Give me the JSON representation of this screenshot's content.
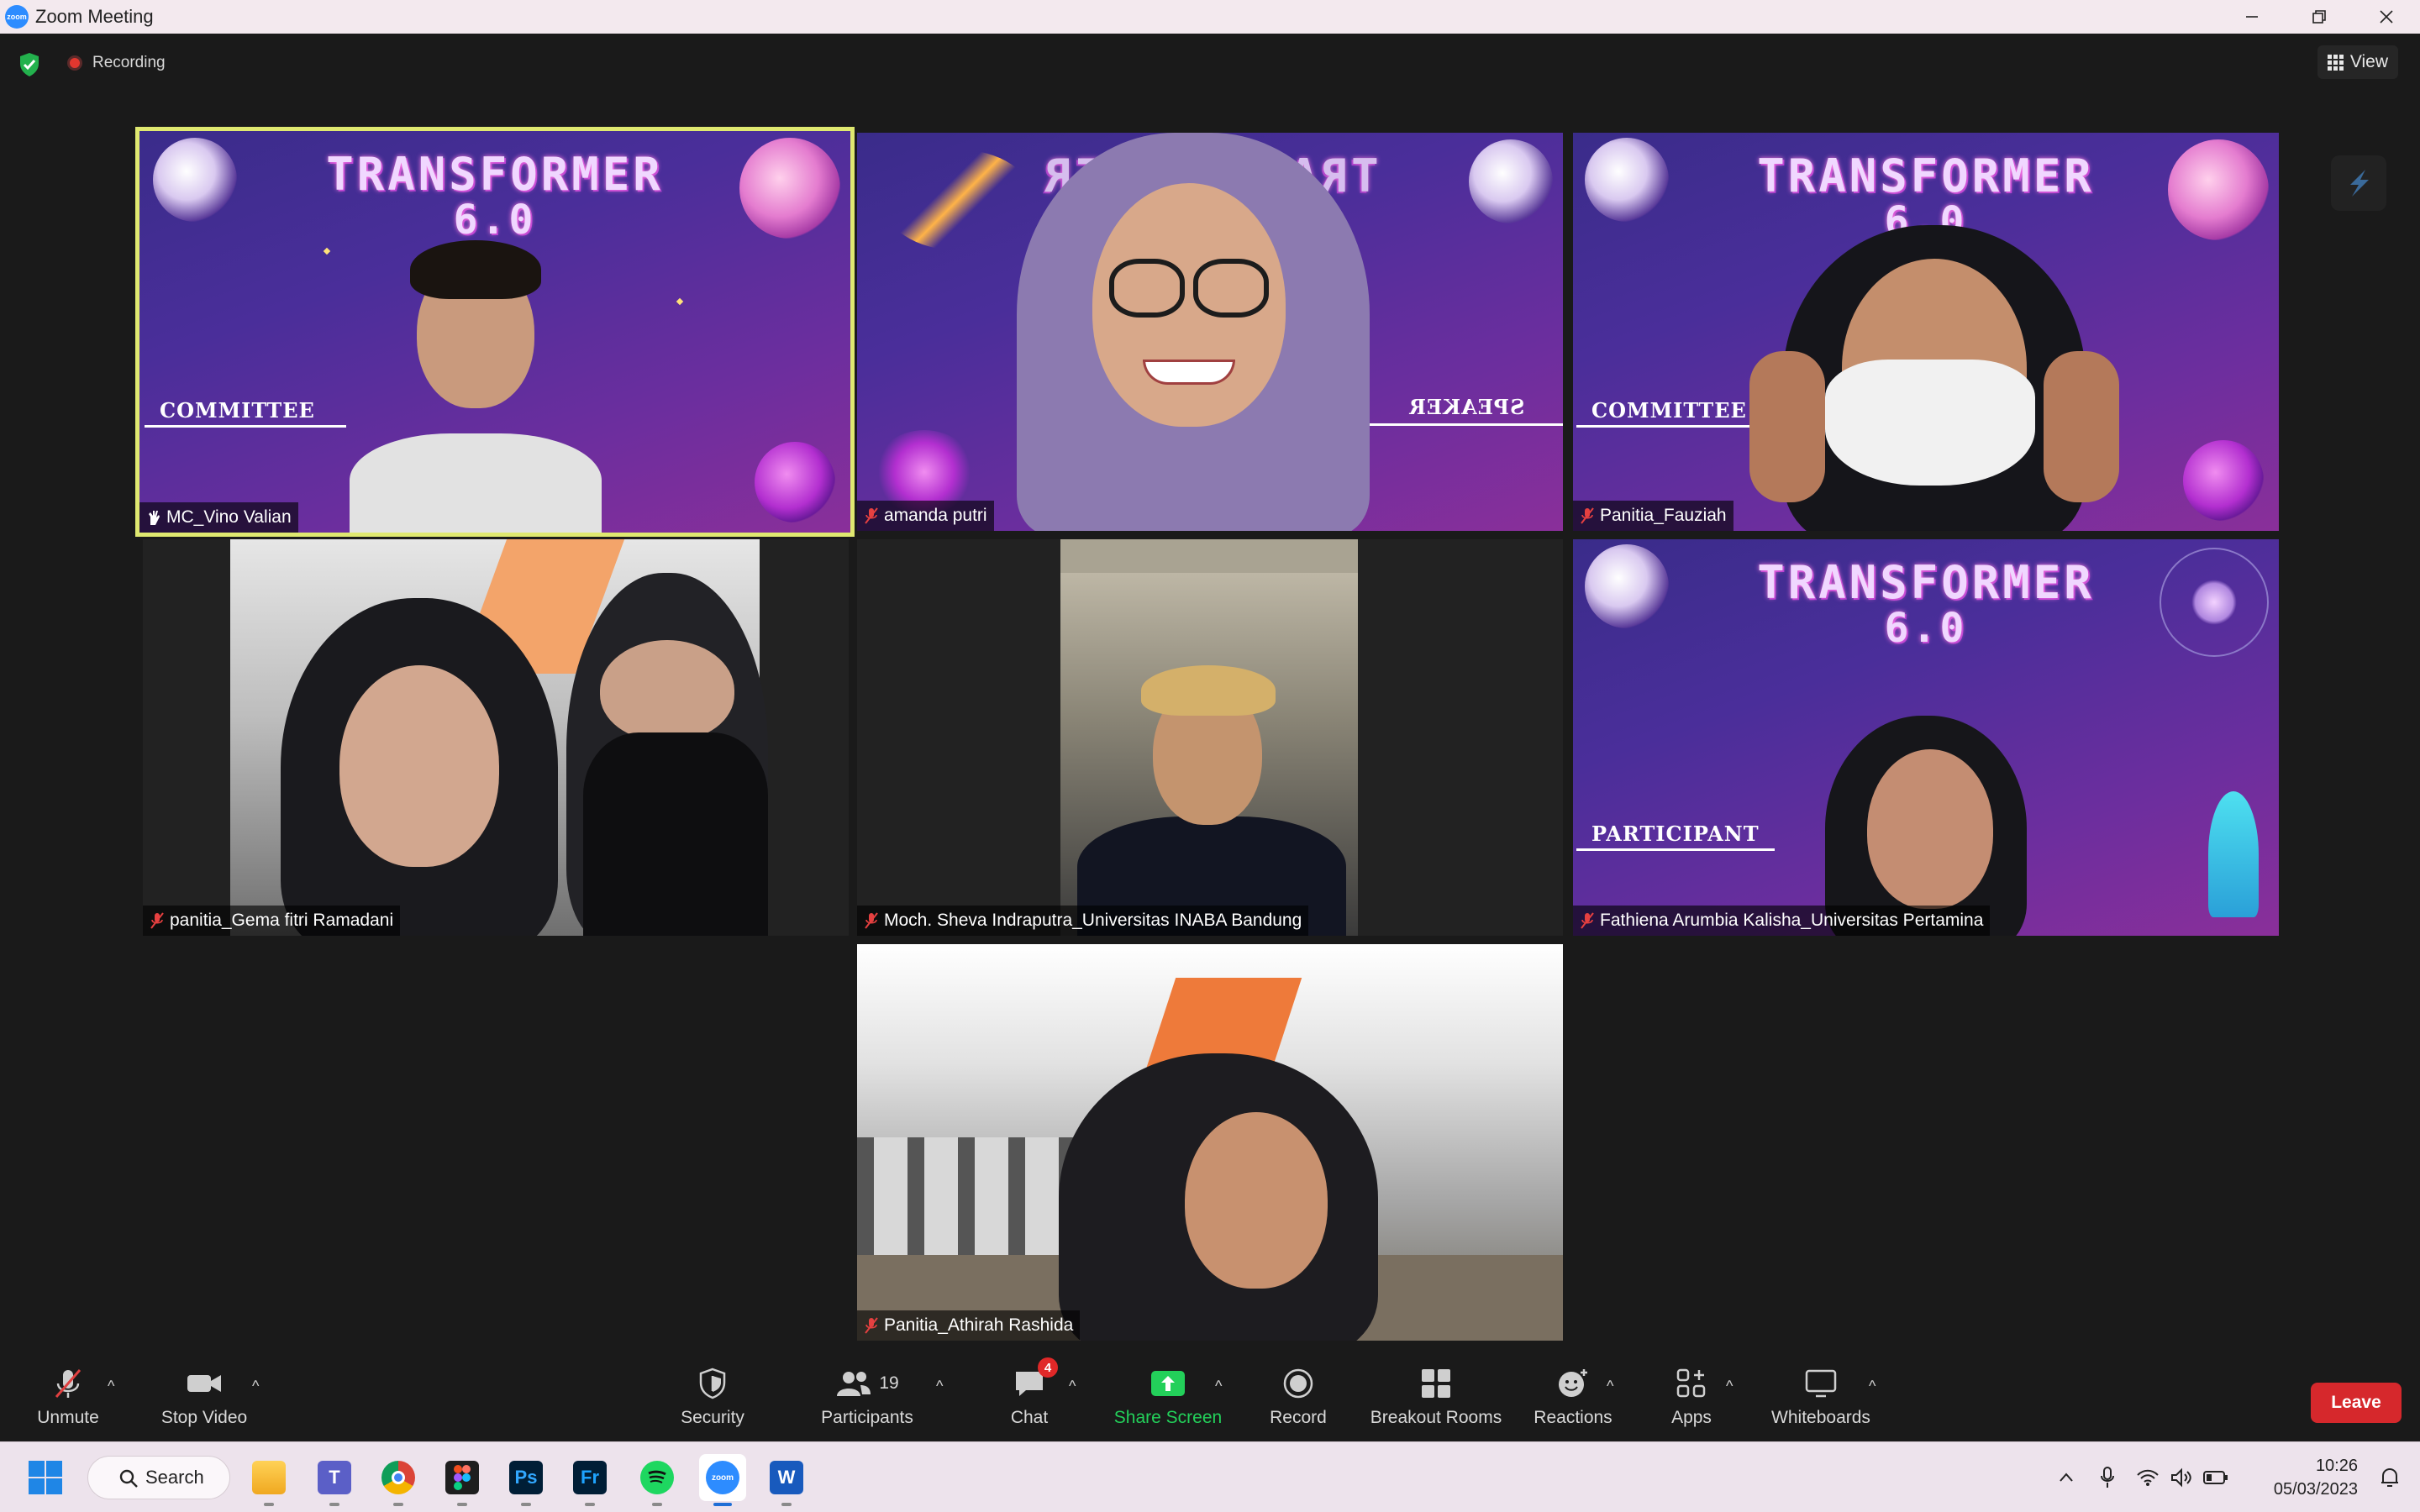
{
  "window": {
    "title": "Zoom Meeting",
    "app_icon_text": "zoom"
  },
  "meeting": {
    "recording_label": "Recording",
    "view_label": "View"
  },
  "participants_tiles": [
    {
      "name": "MC_Vino Valian",
      "role": "COMMITTEE",
      "banner1": "TRANSFORMER",
      "banner2": "6.0",
      "muted": false,
      "active_speaker": true
    },
    {
      "name": "amanda putri",
      "role": "SPEAKER",
      "banner1": "TRANSFORMER",
      "muted": true
    },
    {
      "name": "Panitia_Fauziah",
      "role": "COMMITTEE",
      "banner1": "TRANSFORMER",
      "banner2": "6.0",
      "muted": true
    },
    {
      "name": "panitia_Gema fitri Ramadani",
      "muted": true
    },
    {
      "name": "Moch. Sheva Indraputra_Universitas INABA Bandung",
      "muted": true
    },
    {
      "name": "Fathiena Arumbia Kalisha_Universitas Pertamina",
      "role": "PARTICIPANT",
      "banner1": "TRANSFORMER",
      "banner2": "6.0",
      "muted": true
    },
    {
      "name": "Panitia_Athirah Rashida",
      "muted": true
    }
  ],
  "toolbar": {
    "unmute": "Unmute",
    "stop_video": "Stop Video",
    "security": "Security",
    "participants": "Participants",
    "participants_count": "19",
    "chat": "Chat",
    "chat_badge": "4",
    "share_screen": "Share Screen",
    "record": "Record",
    "breakout_rooms": "Breakout Rooms",
    "reactions": "Reactions",
    "apps": "Apps",
    "whiteboards": "Whiteboards",
    "leave": "Leave"
  },
  "taskbar": {
    "search_label": "Search",
    "apps": [
      "file-explorer",
      "teams",
      "chrome",
      "figma",
      "photoshop",
      "fresco",
      "spotify",
      "zoom",
      "word"
    ],
    "time": "10:26",
    "date": "05/03/2023"
  },
  "colors": {
    "active_speaker_border": "#dfe870",
    "share_green": "#23d05a",
    "leave_red": "#d6282c",
    "badge_red": "#e02828",
    "zoom_blue": "#2d8cff"
  }
}
